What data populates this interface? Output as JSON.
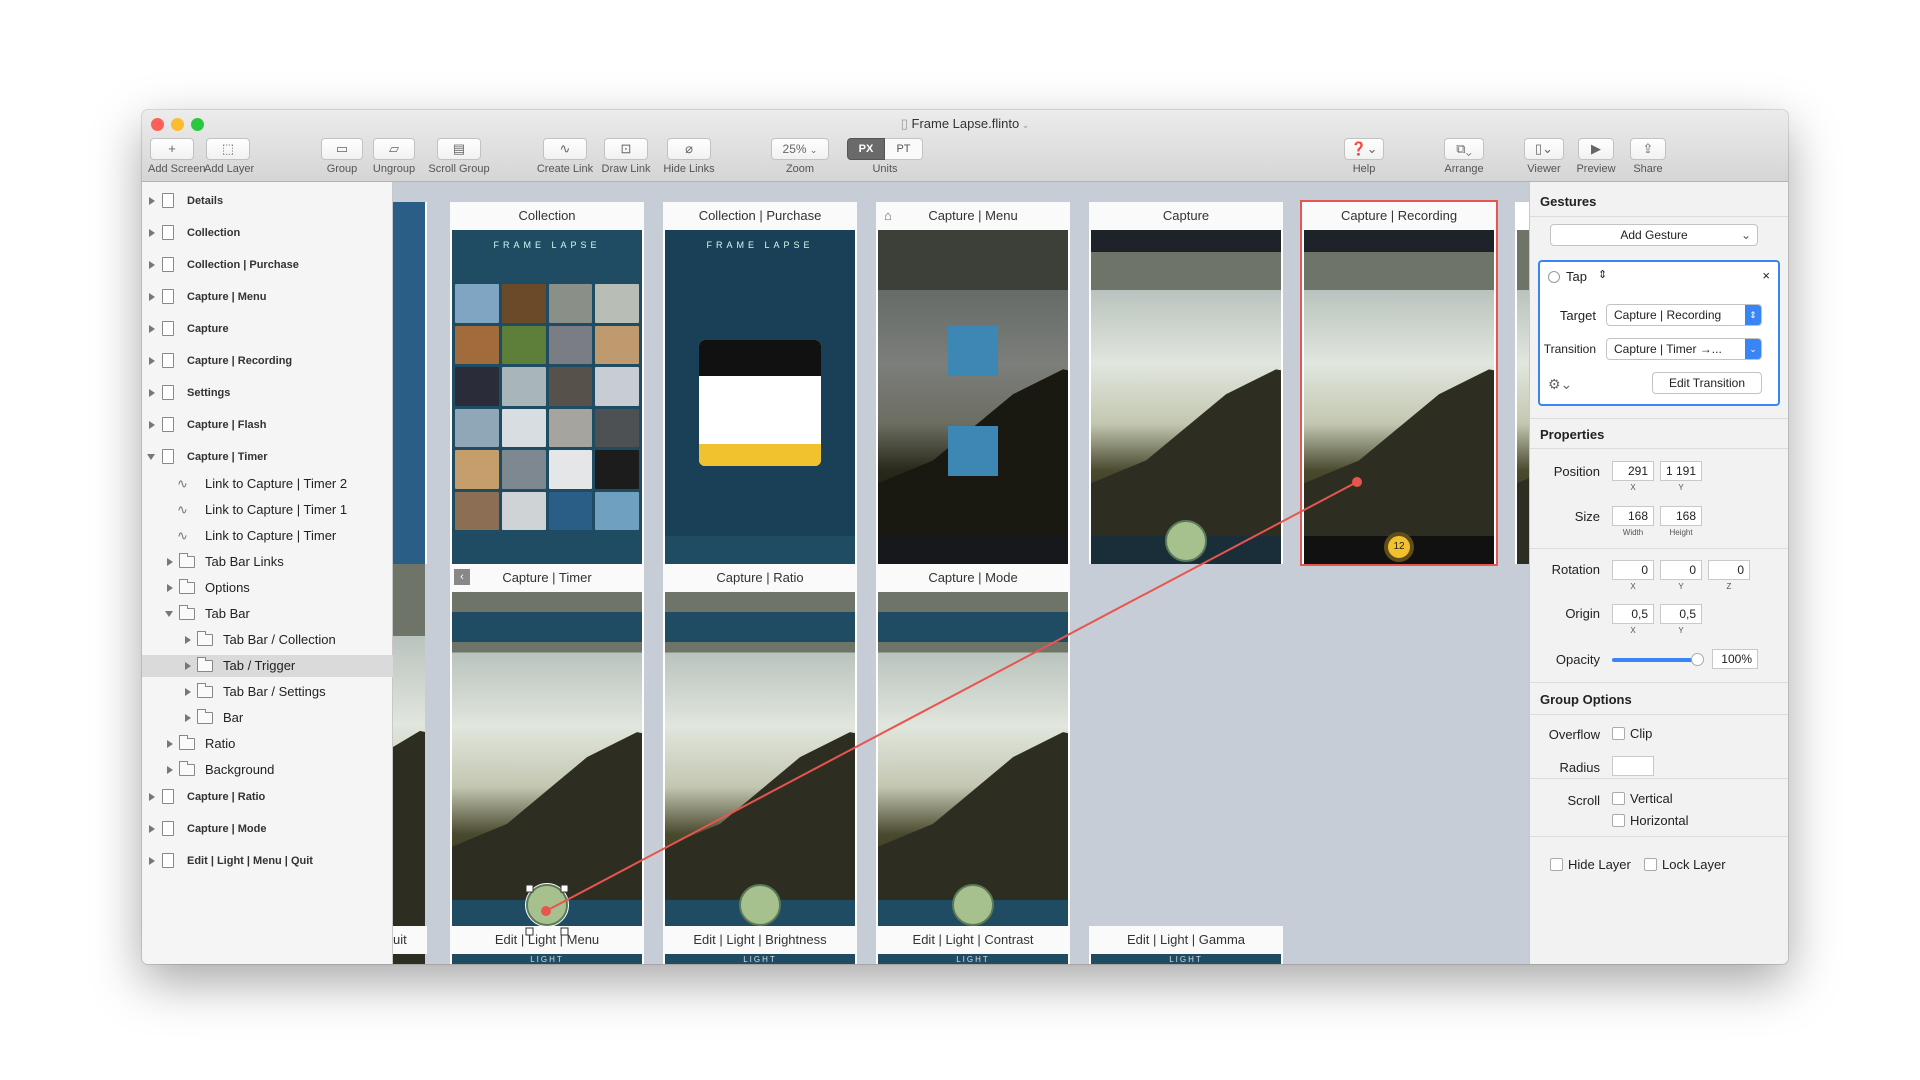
{
  "window": {
    "title": "Frame Lapse.flinto"
  },
  "toolbar": {
    "add_screen": "Add Screen",
    "add_layer": "Add Layer",
    "group": "Group",
    "ungroup": "Ungroup",
    "scroll_group": "Scroll Group",
    "create_link": "Create Link",
    "draw_link": "Draw Link",
    "hide_links": "Hide Links",
    "zoom_value": "25%",
    "zoom_label": "Zoom",
    "unit_px": "PX",
    "unit_pt": "PT",
    "units_label": "Units",
    "help": "Help",
    "arrange": "Arrange",
    "viewer": "Viewer",
    "preview": "Preview",
    "share": "Share"
  },
  "layers": [
    {
      "label": "Details"
    },
    {
      "label": "Collection"
    },
    {
      "label": "Collection | Purchase"
    },
    {
      "label": "Capture | Menu"
    },
    {
      "label": "Capture"
    },
    {
      "label": "Capture | Recording"
    },
    {
      "label": "Settings"
    },
    {
      "label": "Capture | Flash"
    },
    {
      "label": "Capture | Timer"
    },
    {
      "label": "Link to Capture | Timer 2"
    },
    {
      "label": "Link to Capture | Timer 1"
    },
    {
      "label": "Link to Capture | Timer"
    },
    {
      "label": "Tab Bar Links"
    },
    {
      "label": "Options"
    },
    {
      "label": "Tab Bar"
    },
    {
      "label": "Tab Bar / Collection"
    },
    {
      "label": "Tab / Trigger"
    },
    {
      "label": "Tab Bar / Settings"
    },
    {
      "label": "Bar"
    },
    {
      "label": "Ratio"
    },
    {
      "label": "Background"
    },
    {
      "label": "Capture | Ratio"
    },
    {
      "label": "Capture | Mode"
    },
    {
      "label": "Edit | Light | Menu | Quit"
    }
  ],
  "screens": [
    {
      "title": "Collection"
    },
    {
      "title": "Collection | Purchase"
    },
    {
      "title": "Capture | Menu"
    },
    {
      "title": "Capture"
    },
    {
      "title": "Capture | Recording"
    },
    {
      "title": "Capture | Timer"
    },
    {
      "title": "Capture | Ratio"
    },
    {
      "title": "Capture | Mode"
    },
    {
      "title": "Edit | Light | Menu"
    },
    {
      "title": "Edit | Light | Brightness"
    },
    {
      "title": "Edit | Light | Contrast"
    },
    {
      "title": "Edit | Light | Gamma"
    }
  ],
  "canvas": {
    "brand": "FRAME LAPSE",
    "timer_count": "12",
    "light": "LIGHT",
    "edge_text": "uit"
  },
  "inspector": {
    "gestures_header": "Gestures",
    "add_gesture": "Add Gesture",
    "gesture_name": "Tap",
    "target_label": "Target",
    "target_value": "Capture | Recording",
    "transition_label": "Transition",
    "transition_value": "Capture | Timer →...",
    "edit_transition": "Edit Transition",
    "properties_header": "Properties",
    "position_label": "Position",
    "pos_x": "291",
    "pos_y": "1 191",
    "size_label": "Size",
    "width": "168",
    "height": "168",
    "width_label": "Width",
    "height_label": "Height",
    "rotation_label": "Rotation",
    "rot_x": "0",
    "rot_y": "0",
    "rot_z": "0",
    "origin_label": "Origin",
    "origin_x": "0,5",
    "origin_y": "0,5",
    "opacity_label": "Opacity",
    "opacity_value": "100%",
    "opacity_level": 1.0,
    "x": "X",
    "y": "Y",
    "z": "Z",
    "group_options_header": "Group Options",
    "overflow_label": "Overflow",
    "clip": "Clip",
    "radius_label": "Radius",
    "scroll_label": "Scroll",
    "vertical": "Vertical",
    "horizontal": "Horizontal",
    "hide_layer": "Hide Layer",
    "lock_layer": "Lock Layer"
  },
  "colors": {
    "selection": "#e8554e",
    "accent": "#3a85f5",
    "app_teal": "#1f4b63",
    "capture_btn": "#a7c18e",
    "timer_badge": "#f2c12e"
  }
}
